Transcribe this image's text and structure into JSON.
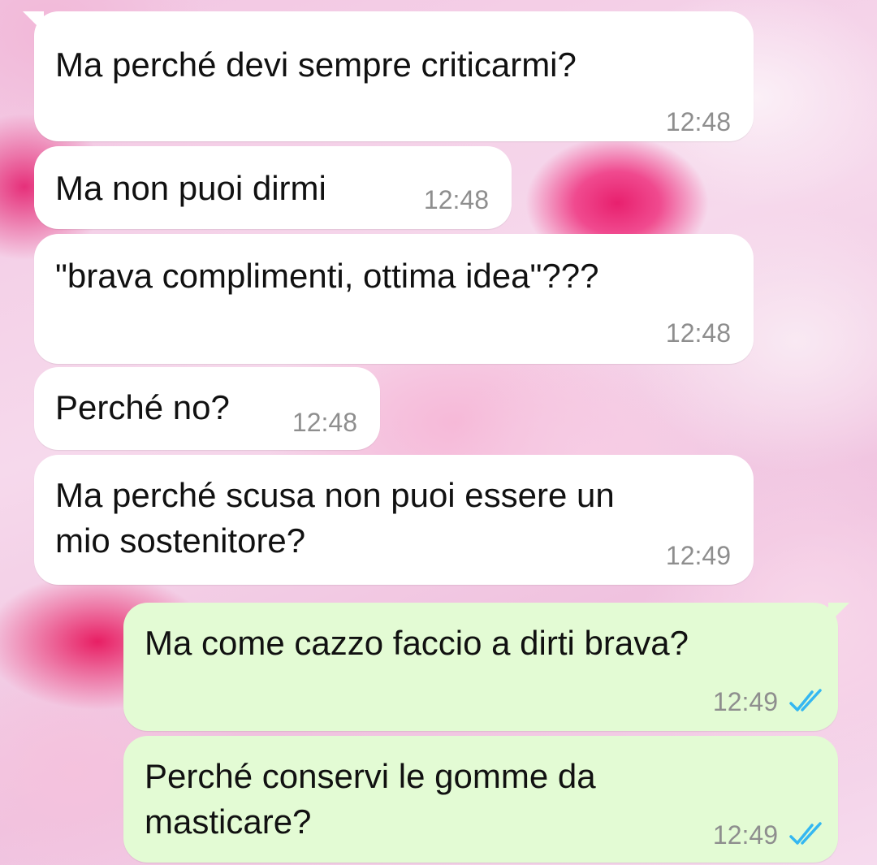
{
  "chat": {
    "messages": [
      {
        "text": "Ma perché devi sempre criticarmi?",
        "time": "12:48",
        "direction": "incoming"
      },
      {
        "text": "Ma non puoi dirmi",
        "time": "12:48",
        "direction": "incoming"
      },
      {
        "text": "\"brava complimenti, ottima idea\"???",
        "time": "12:48",
        "direction": "incoming"
      },
      {
        "text": "Perché no?",
        "time": "12:48",
        "direction": "incoming"
      },
      {
        "text": "Ma perché scusa  non puoi essere un\nmio sostenitore?",
        "time": "12:49",
        "direction": "incoming"
      },
      {
        "text": "Ma come cazzo faccio a dirti brava?",
        "time": "12:49",
        "direction": "outgoing",
        "status": "read"
      },
      {
        "text": "Perché conservi le gomme da\nmasticare?",
        "time": "12:49",
        "direction": "outgoing",
        "status": "read"
      }
    ]
  },
  "colors": {
    "incoming_bubble": "#ffffff",
    "outgoing_bubble": "#e3fbd4",
    "read_ticks": "#34b7f1",
    "timestamp": "#8e8e8e"
  },
  "icons": {
    "read_receipt": "double-check-icon"
  }
}
